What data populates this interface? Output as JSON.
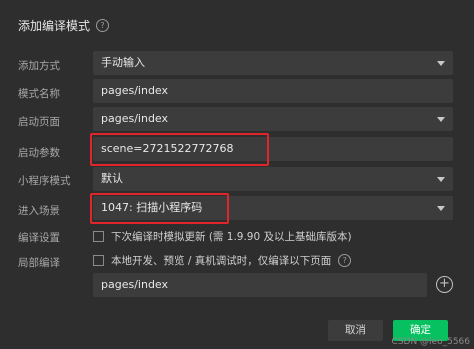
{
  "dialog": {
    "title": "添加编译模式",
    "help_icon": "?"
  },
  "form": {
    "add_method": {
      "label": "添加方式",
      "value": "手动输入"
    },
    "mode_name": {
      "label": "模式名称",
      "value": "pages/index"
    },
    "start_page": {
      "label": "启动页面",
      "value": "pages/index"
    },
    "start_params": {
      "label": "启动参数",
      "value": "scene=2721522772768"
    },
    "mini_program_mode": {
      "label": "小程序模式",
      "value": "默认"
    },
    "entry_scene": {
      "label": "进入场景",
      "value": "1047: 扫描小程序码"
    },
    "compile_settings": {
      "label": "编译设置",
      "checkbox_text": "下次编译时模拟更新 (需 1.9.90 及以上基础库版本)"
    },
    "partial_compile": {
      "label": "局部编译",
      "checkbox_text": "本地开发、预览 / 真机调试时，仅编译以下页面",
      "page_value": "pages/index"
    }
  },
  "buttons": {
    "cancel": "取消",
    "confirm": "确定"
  },
  "watermark": "CSDN @leo_5566",
  "colors": {
    "background": "#2e2e2e",
    "field": "#3c3c3c",
    "highlight": "#e0262a",
    "confirm": "#07c160"
  }
}
